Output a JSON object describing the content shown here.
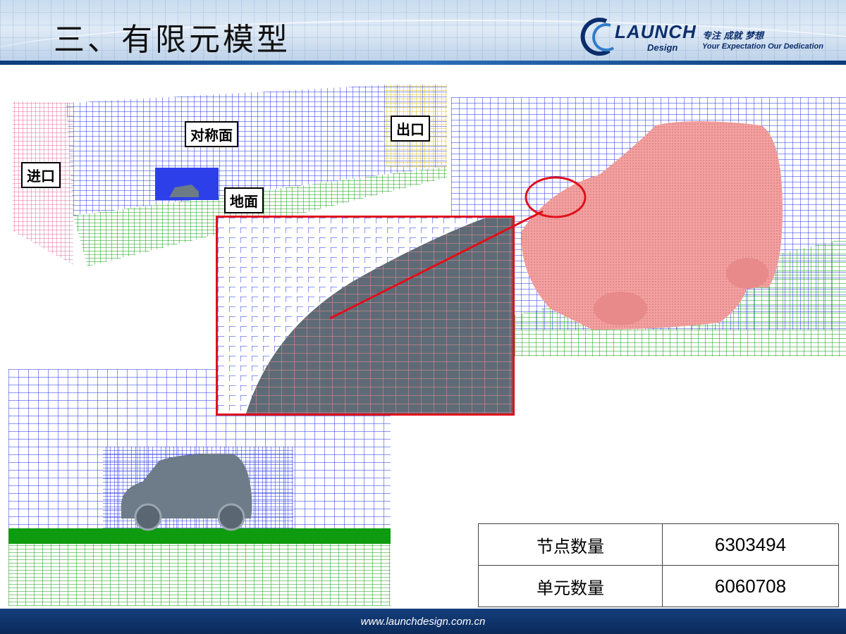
{
  "title": "三、有限元模型",
  "logo": {
    "name": "LAUNCH",
    "sub": "Design",
    "cn": "专注 成就 梦想",
    "tagline": "Your Expectation Our Dedication"
  },
  "labels": {
    "inlet": "进口",
    "symmetry": "对称面",
    "outlet": "出口",
    "ground": "地面"
  },
  "stats": [
    {
      "key": "节点数量",
      "value": "6303494"
    },
    {
      "key": "单元数量",
      "value": "6060708"
    }
  ],
  "footer": "www.launchdesign.com.cn",
  "colors": {
    "mesh_blue": "#1f2fe0",
    "mesh_green": "#109a10",
    "car_pink": "#f4a0a0",
    "highlight_red": "#e0101a",
    "header_dark": "#0d3c7a"
  }
}
